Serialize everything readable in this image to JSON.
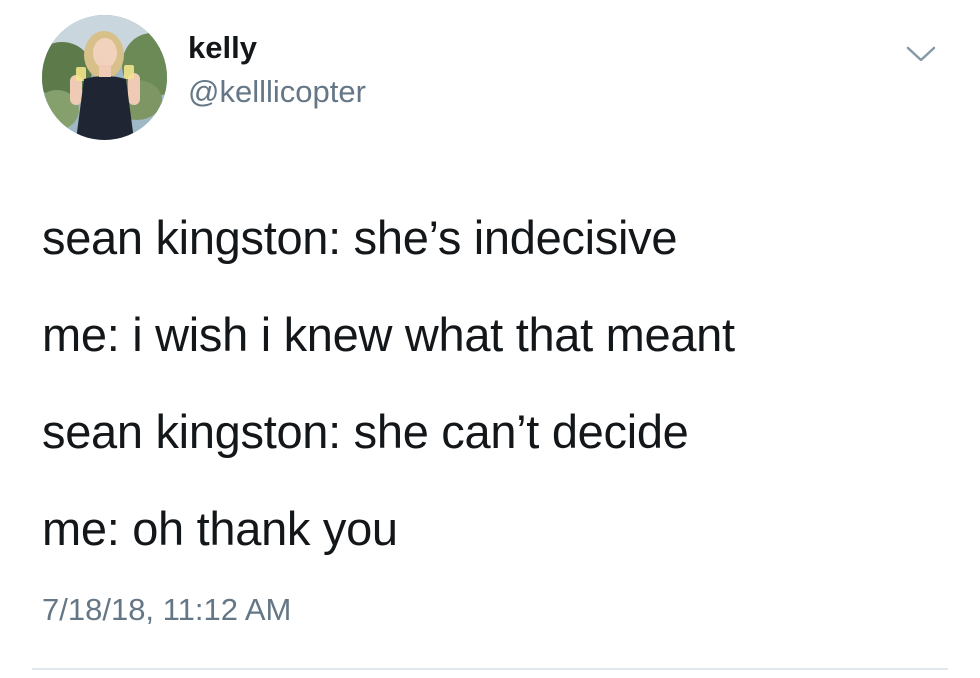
{
  "tweet": {
    "user": {
      "display_name": "kelly",
      "handle": "@kelllicopter",
      "avatar_icon": "profile-photo"
    },
    "menu_icon": "chevron-down-icon",
    "lines": [
      "sean kingston: she’s indecisive",
      "me: i wish i knew what that meant",
      "sean kingston: she can’t decide",
      "me: oh thank you"
    ],
    "timestamp": "7/18/18, 11:12 AM"
  },
  "colors": {
    "primary_text": "#14171a",
    "secondary_text": "#657786",
    "divider": "#e1e8ed",
    "background": "#ffffff"
  }
}
